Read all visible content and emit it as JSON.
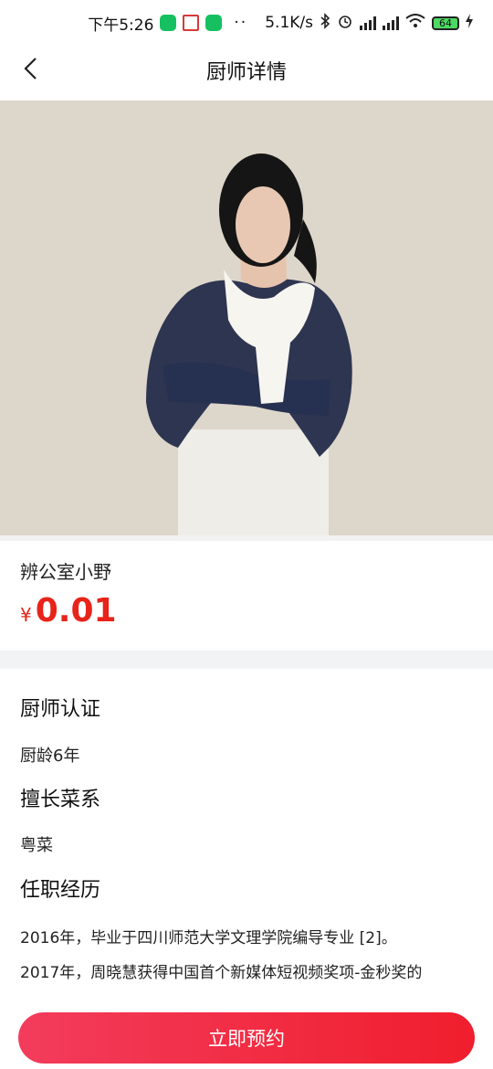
{
  "status_bar": {
    "time": "下午5:26",
    "speed": "5.1K/s",
    "battery": "64"
  },
  "header": {
    "title": "厨师详情"
  },
  "chef": {
    "name": "辨公室小野",
    "currency": "¥",
    "price": "0.01"
  },
  "sections": {
    "cert_title": "厨师认证",
    "cert_value": "厨龄6年",
    "cuisine_title": "擅长菜系",
    "cuisine_value": "粤菜",
    "experience_title": "任职经历",
    "experience_lines": [
      "2016年，毕业于四川师范大学文理学院编导专业 [2]。",
      "2017年，周晓慧获得中国首个新媒体短视频奖项-金秒奖的"
    ]
  },
  "book_button": "立即预约",
  "colors": {
    "accent": "#e8231a",
    "button_start": "#f33c5c",
    "button_end": "#f01e2d"
  }
}
